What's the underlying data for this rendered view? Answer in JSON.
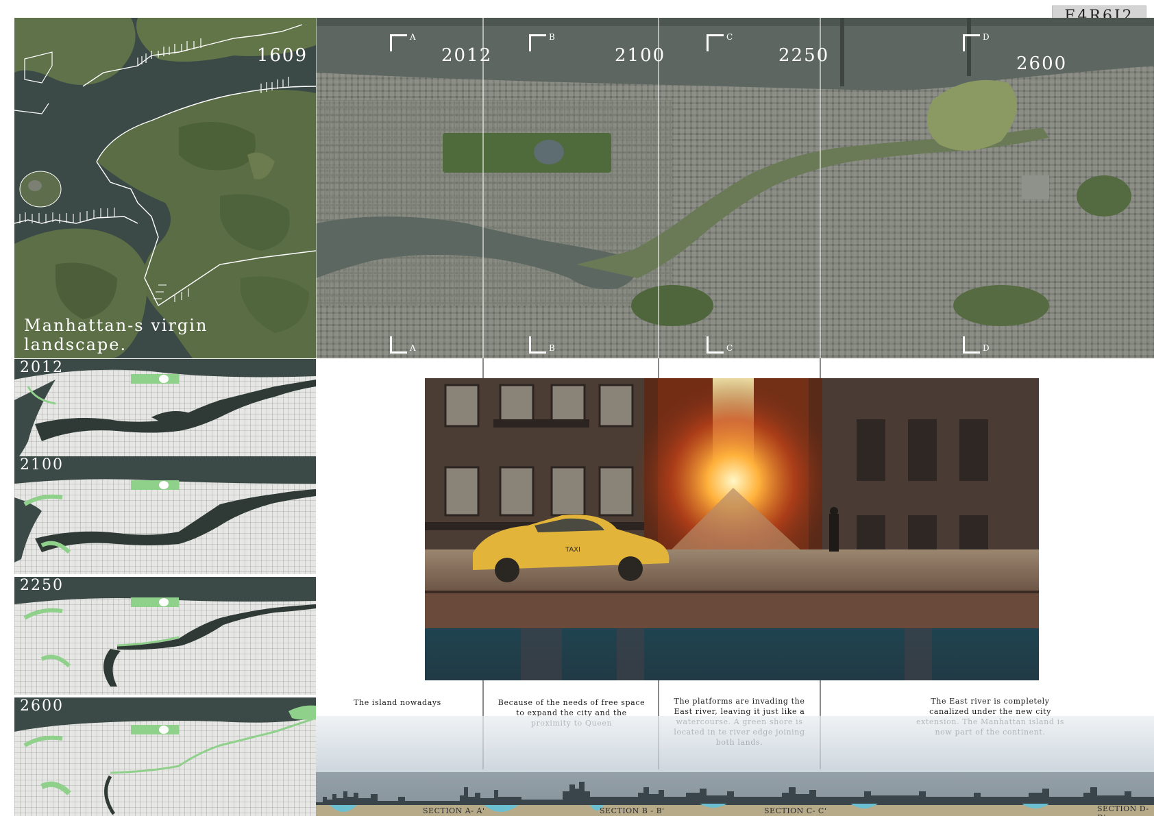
{
  "board": {
    "code": "E4R6I2"
  },
  "virgin_map": {
    "year": "1609",
    "caption": "Manhattan-s virgin landscape."
  },
  "aerial": {
    "years": [
      "2012",
      "2100",
      "2250",
      "2600"
    ],
    "section_markers": [
      "A",
      "B",
      "C",
      "D"
    ]
  },
  "evolution_maps": [
    {
      "year": "2012"
    },
    {
      "year": "2100"
    },
    {
      "year": "2250"
    },
    {
      "year": "2600"
    }
  ],
  "descriptions": [
    "The island nowadays",
    "Because of the needs of free space to expand the city and the proximity to Queen",
    "The platforms are invading the East river, leaving it just like a watercourse. A green shore is located in te river edge joining both lands.",
    "The East river is completely canalized under the new city extension. The Manhattan island is now part of the     continent."
  ],
  "sections": [
    "SECTION A- A'",
    "SECTION B - B'",
    "SECTION C- C'",
    "SECTION D-D'"
  ],
  "colors": {
    "dark_slate": "#3b4a46",
    "forest_green": "#5f7249",
    "park_green": "#8fd08a",
    "water_grey": "#5e6662"
  },
  "render": {
    "taxi_sign": "TAXI"
  }
}
